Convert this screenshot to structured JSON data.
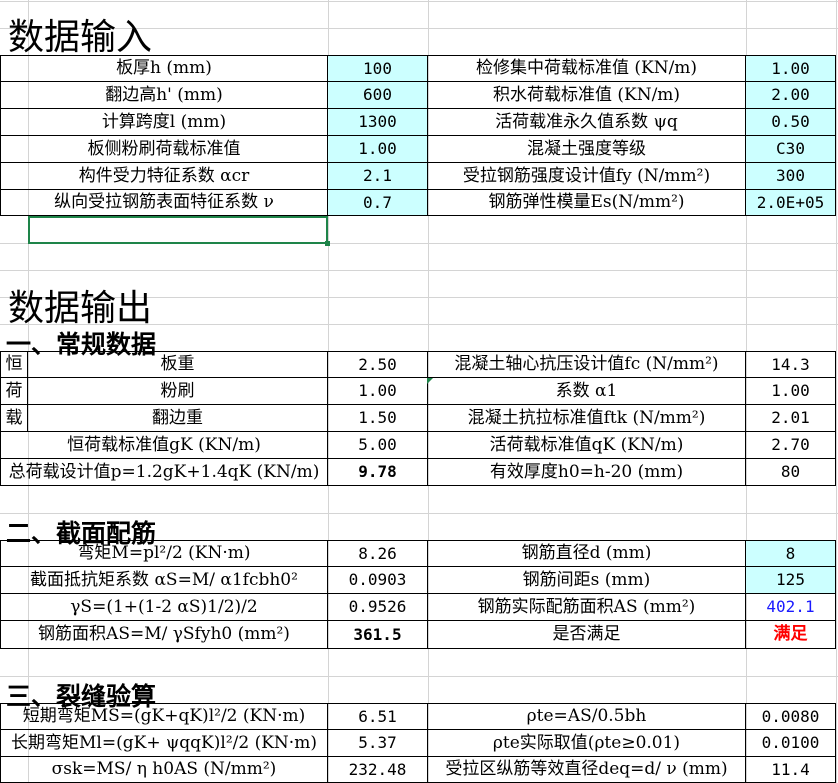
{
  "titles": {
    "input": "数据输入",
    "output": "数据输出",
    "sec1": "一、常规数据",
    "sec2": "二、截面配筋",
    "sec3": "三、裂缝验算"
  },
  "input_rows": [
    {
      "l1": "板厚h (mm)",
      "v1": "100",
      "l2": "检修集中荷载标准值 (KN/m)",
      "v2": "1.00"
    },
    {
      "l1": "翻边高h' (mm)",
      "v1": "600",
      "l2": "积水荷载标准值 (KN/m)",
      "v2": "2.00"
    },
    {
      "l1": "计算跨度l (mm)",
      "v1": "1300",
      "l2": "活荷载准永久值系数 ψq",
      "v2": "0.50"
    },
    {
      "l1": "板侧粉刷荷载标准值",
      "v1": "1.00",
      "l2": "混凝土强度等级",
      "v2": "C30"
    },
    {
      "l1": "构件受力特征系数 αcr",
      "v1": "2.1",
      "l2": "受拉钢筋强度设计值fy (N/mm²)",
      "v2": "300"
    },
    {
      "l1": "纵向受拉钢筋表面特征系数 ν",
      "v1": "0.7",
      "l2": "钢筋弹性模量Es(N/mm²)",
      "v2": "2.0E+05"
    }
  ],
  "dead_load": {
    "side_chars": [
      "恒",
      "荷",
      "载"
    ],
    "rows": [
      {
        "l1": "板重",
        "v1": "2.50",
        "l2": "混凝土轴心抗压设计值fc (N/mm²)",
        "v2": "14.3"
      },
      {
        "l1": "粉刷",
        "v1": "1.00",
        "l2": "系数 α1",
        "v2": "1.00"
      },
      {
        "l1": "翻边重",
        "v1": "1.50",
        "l2": "混凝土抗拉标准值ftk (N/mm²)",
        "v2": "2.01"
      }
    ]
  },
  "general_rows": [
    {
      "l1": "恒荷载标准值gK (KN/m)",
      "v1": "5.00",
      "l2": "活荷载标准值qK (KN/m)",
      "v2": "2.70"
    },
    {
      "l1": "总荷载设计值p=1.2gK+1.4qK (KN/m)",
      "v1": "9.78",
      "l2": "有效厚度h0=h-20 (mm)",
      "v2": "80"
    }
  ],
  "section_rows": [
    {
      "l1": "弯矩M=pl²/2 (KN·m)",
      "v1": "8.26",
      "l2": "钢筋直径d (mm)",
      "v2": "8"
    },
    {
      "l1": "截面抵抗矩系数 αS=M/ α1fcbh0²",
      "v1": "0.0903",
      "l2": "钢筋间距s (mm)",
      "v2": "125"
    },
    {
      "l1": "γS=(1+(1-2 αS)1/2)/2",
      "v1": "0.9526",
      "l2": "钢筋实际配筋面积AS (mm²)",
      "v2": "402.1"
    },
    {
      "l1": "钢筋面积AS=M/ γSfyh0 (mm²)",
      "v1": "361.5",
      "l2": "是否满足",
      "v2": "满足"
    }
  ],
  "crack_rows": [
    {
      "l1": "短期弯矩MS=(gK+qK)l²/2 (KN·m)",
      "v1": "6.51",
      "l2": "ρte=AS/0.5bh",
      "v2": "0.0080"
    },
    {
      "l1": "长期弯矩Ml=(gK+ ψqqK)l²/2 (KN·m)",
      "v1": "5.37",
      "l2": "ρte实际取值(ρte≥0.01)",
      "v2": "0.0100"
    },
    {
      "l1": "σsk=MS/ η h0AS (N/mm²)",
      "v1": "232.48",
      "l2": "受拉区纵筋等效直径deq=d/ ν (mm)",
      "v2": "11.4"
    }
  ]
}
